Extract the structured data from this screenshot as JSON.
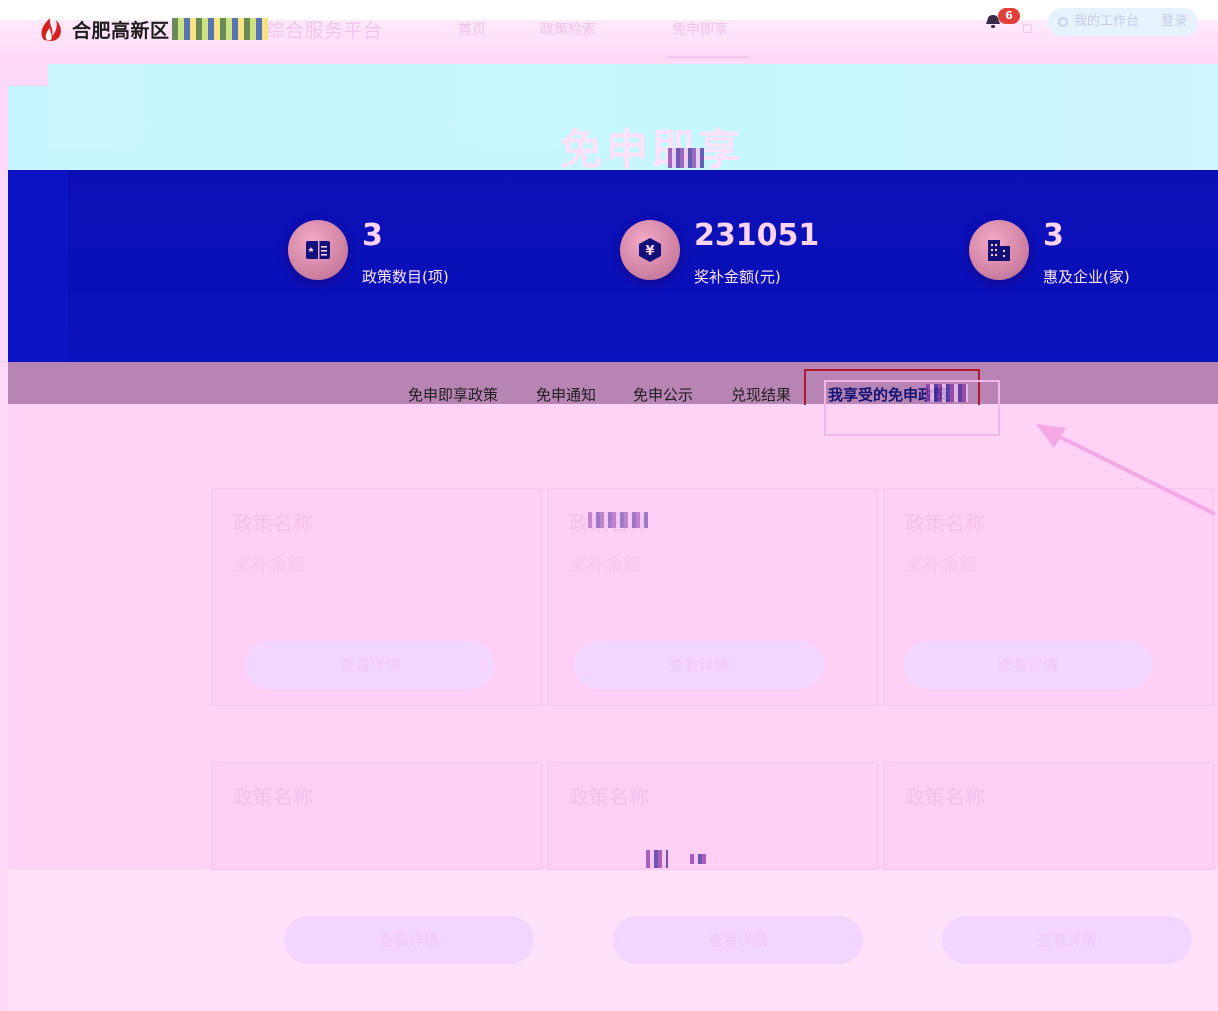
{
  "header": {
    "brand_main": "合肥高新区",
    "brand_tail": "综合服务平台",
    "nav": [
      {
        "label": "首页"
      },
      {
        "label": "政策检索"
      },
      {
        "label": "免申即享"
      }
    ],
    "notification_count": "6",
    "login_text": "我的工作台",
    "tail_text": "登录"
  },
  "banner": {
    "title": "免申即享",
    "stats": [
      {
        "value": "3",
        "label": "政策数目(项)",
        "icon": "book-icon"
      },
      {
        "value": "231051",
        "label": "奖补金额(元)",
        "icon": "yuan-shield-icon"
      },
      {
        "value": "3",
        "label": "惠及企业(家)",
        "icon": "building-icon"
      }
    ]
  },
  "tabs": [
    {
      "label": "免申即享政策"
    },
    {
      "label": "免申通知"
    },
    {
      "label": "免申公示"
    },
    {
      "label": "兑现结果"
    },
    {
      "label": "我享受的免申政策"
    }
  ],
  "active_tab_index": 4,
  "cards": {
    "row1": [
      {
        "title": "政策名称",
        "sub": "奖补金额",
        "button": "查看详情"
      },
      {
        "title": "政策名称",
        "sub": "奖补金额",
        "button": "查看详情"
      },
      {
        "title": "政策名称",
        "sub": "奖补金额",
        "button": "查看详情"
      }
    ],
    "row2": [
      {
        "title": "政策名称",
        "button": "查看详情"
      },
      {
        "title": "政策名称",
        "button": "查看详情"
      },
      {
        "title": "政策名称",
        "button": "查看详情"
      }
    ]
  },
  "colors": {
    "banner_blue": "#0e0fb6",
    "banner_cyan": "#c9f6ff",
    "page_pink": "#ffd9f7",
    "tab_strip": "#b884b3",
    "active_border": "#b01a2f",
    "badge_red": "#e0413a"
  }
}
